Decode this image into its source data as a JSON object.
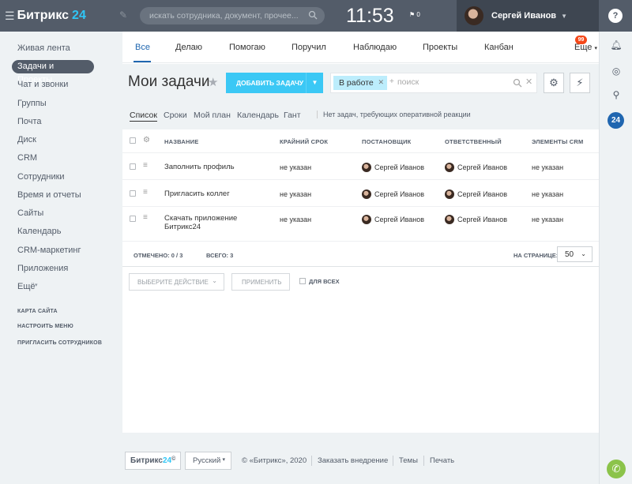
{
  "header": {
    "logo_text": "Битрикс",
    "logo_num": "24",
    "search_placeholder": "искать сотрудника, документ, прочее...",
    "clock": "11:53",
    "flag_count": "0",
    "user_name": "Сергей Иванов",
    "help": "?"
  },
  "left_menu": {
    "items": [
      "Живая лента",
      "Задачи и Проекты",
      "Чат и звонки",
      "Группы",
      "Почта",
      "Диск",
      "CRM",
      "Сотрудники",
      "Время и отчеты",
      "Сайты",
      "Календарь",
      "CRM-маркетинг",
      "Приложения",
      "Ещё"
    ],
    "active_index": 1,
    "links": [
      "КАРТА САЙТА",
      "НАСТРОИТЬ МЕНЮ",
      "ПРИГЛАСИТЬ СОТРУДНИКОВ"
    ]
  },
  "tabs": {
    "items": [
      "Все",
      "Делаю",
      "Помогаю",
      "Поручил",
      "Наблюдаю",
      "Проекты",
      "Канбан"
    ],
    "more": "Еще",
    "more_badge": "99"
  },
  "page": {
    "title": "Мои задачи",
    "add_button": "ДОБАВИТЬ ЗАДАЧУ",
    "filter_tag": "В работе",
    "filter_placeholder": "поиск"
  },
  "view_tabs": {
    "items": [
      "Список",
      "Сроки",
      "Мой план",
      "Календарь",
      "Гант"
    ],
    "note": "Нет задач, требующих оперативной реакции"
  },
  "grid": {
    "columns": [
      "НАЗВАНИЕ",
      "КРАЙНИЙ СРОК",
      "ПОСТАНОВЩИК",
      "ОТВЕТСТВЕННЫЙ",
      "ЭЛЕМЕНТЫ CRM"
    ],
    "rows": [
      {
        "name": "Заполнить профиль",
        "deadline": "не указан",
        "creator": "Сергей Иванов",
        "responsible": "Сергей Иванов",
        "crm": "не указан"
      },
      {
        "name": "Пригласить коллег",
        "deadline": "не указан",
        "creator": "Сергей Иванов",
        "responsible": "Сергей Иванов",
        "crm": "не указан"
      },
      {
        "name": "Скачать приложение Битрикс24",
        "deadline": "не указан",
        "creator": "Сергей Иванов",
        "responsible": "Сергей Иванов",
        "crm": "не указан"
      }
    ],
    "selected_label": "ОТМЕЧЕНО:",
    "selected_value": "0 / 3",
    "total_label": "ВСЕГО:",
    "total_value": "3",
    "per_page_label": "НА СТРАНИЦЕ:",
    "per_page_value": "50"
  },
  "actions": {
    "select_action": "ВЫБЕРИТЕ ДЕЙСТВИЕ",
    "apply": "ПРИМЕНИТЬ",
    "for_all": "ДЛЯ ВСЕХ"
  },
  "footer": {
    "logo_text": "Битрикс",
    "logo_num": "24",
    "language": "Русский",
    "copyright": "© «Битрикс», 2020",
    "links": [
      "Заказать внедрение",
      "Темы",
      "Печать"
    ]
  },
  "colors": {
    "header": "#535c69",
    "accent": "#3bc8f5",
    "tab_active": "#2067b0",
    "badge": "#f54819"
  }
}
